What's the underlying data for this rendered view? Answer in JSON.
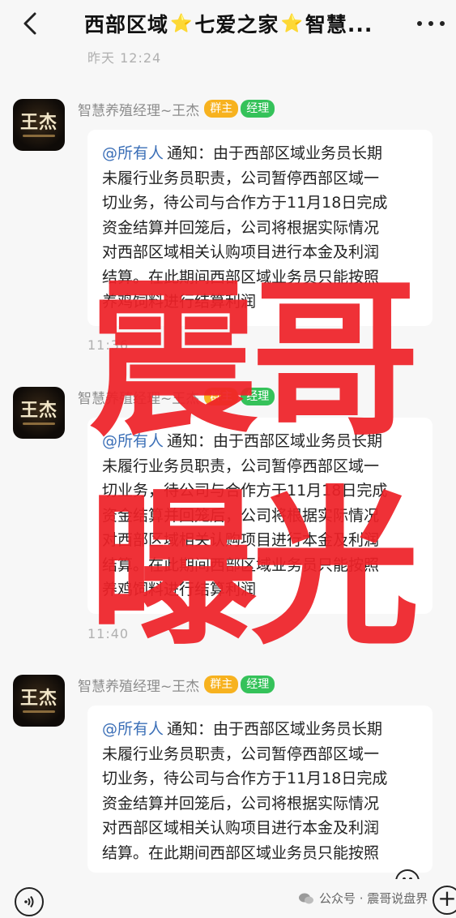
{
  "header": {
    "title_part1": "西部区域",
    "title_part2": "七爱之家",
    "title_part3": "智慧...",
    "star": "⭐"
  },
  "timestamps": [
    "昨天 12:24",
    "11:36",
    "11:40"
  ],
  "messages": [
    {
      "sender": "智慧养殖经理~王杰",
      "badge_owner": "群主",
      "badge_manager": "经理",
      "avatar_text": "王杰",
      "mention": "@所有人",
      "lines": [
        "通知：由于西部区域业务员长期",
        "未履行业务员职责，公司暂停西部区域一",
        "切业务，待公司与合作方于11月18日完成",
        "资金结算并回笼后，公司将根据实际情况",
        "对西部区域相关认购项目进行本金及利润",
        "结算。在此期间西部区域业务员只能按照",
        "养鸡饲料进行结算利润"
      ]
    },
    {
      "sender": "智慧养殖经理~王杰",
      "badge_owner": "群主",
      "badge_manager": "经理",
      "avatar_text": "王杰",
      "mention": "@所有人",
      "lines": [
        "通知：由于西部区域业务员长期",
        "未履行业务员职责，公司暂停西部区域一",
        "切业务，待公司与合作方于11月18日完成",
        "资金结算并回笼后，公司将根据实际情况",
        "对西部区域相关认购项目进行本金及利润",
        "结算。在此期间西部区域业务员只能按照",
        "养鸡饲料进行结算利润"
      ]
    },
    {
      "sender": "智慧养殖经理~王杰",
      "badge_owner": "群主",
      "badge_manager": "经理",
      "avatar_text": "王杰",
      "mention": "@所有人",
      "lines": [
        "通知：由于西部区域业务员长期",
        "未履行业务员职责，公司暂停西部区域一",
        "切业务，待公司与合作方于11月18日完成",
        "资金结算并回笼后，公司将根据实际情况",
        "对西部区域相关认购项目进行本金及利润",
        "结算。在此期间西部区域业务员只能按照"
      ]
    }
  ],
  "watermark": {
    "line1": "震哥",
    "line2": "曝光"
  },
  "footer": {
    "source": "公众号 · 震哥说盘界"
  },
  "icons": {
    "back": "chevron-left-icon",
    "more": "more-dots-icon",
    "voice": "voice-icon",
    "emoji": "emoji-icon",
    "plus": "plus-icon",
    "wechat": "wechat-icon"
  },
  "colors": {
    "watermark": "#ee2128",
    "badge_owner": "#f7b21f",
    "badge_manager": "#35c25a",
    "mention": "#3b6fb7"
  }
}
